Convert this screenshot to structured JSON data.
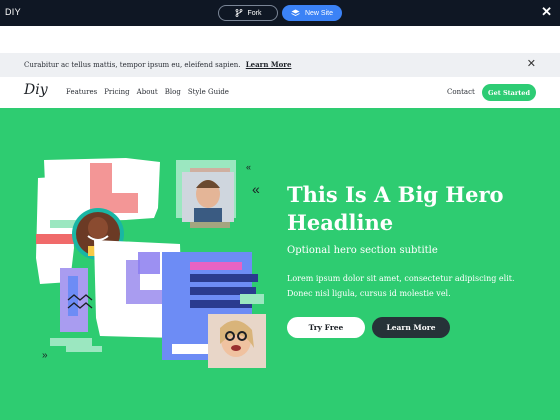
{
  "topbar": {
    "brand": "DIY",
    "fork_label": "Fork",
    "new_site_label": "New Site",
    "close_icon": "close-icon"
  },
  "announcement": {
    "message": "Curabitur ac tellus mattis, tempor ipsum eu, eleifend sapien.",
    "link": "Learn More"
  },
  "nav": {
    "logo": "Diy",
    "links": [
      "Features",
      "Pricing",
      "About",
      "Blog",
      "Style Guide"
    ],
    "contact": "Contact",
    "cta": "Get Started"
  },
  "hero": {
    "title": "This Is A Big Hero Headline",
    "subtitle": "Optional hero section subtitle",
    "body": "Lorem ipsum dolor sit amet, consectetur adipiscing elit. Donec nisl ligula, cursus id molestie vel.",
    "primary_button": "Try Free",
    "secondary_button": "Learn More"
  },
  "colors": {
    "topbar_bg": "#0f1724",
    "accent_blue": "#3b82f6",
    "hero_green": "#2ecc71",
    "cta_green": "#2dcc74",
    "dark_button": "#263238"
  }
}
